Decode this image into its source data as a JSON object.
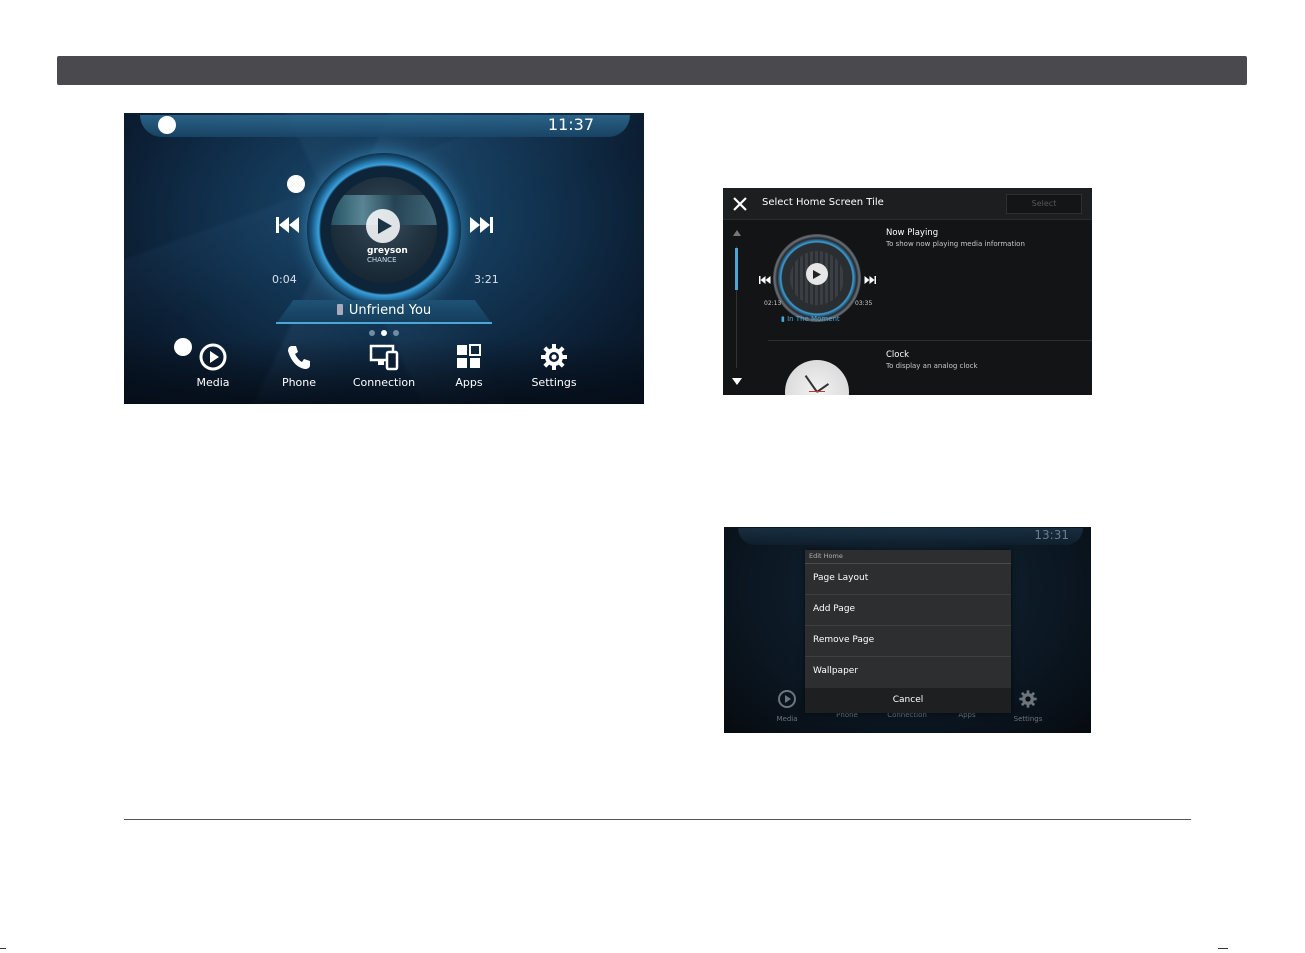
{
  "home_screen": {
    "clock": "11:37",
    "album_artist_line1": "greyson",
    "album_artist_line2": "CHANCE",
    "time_elapsed": "0:04",
    "time_total": "3:21",
    "song_title": "Unfriend You",
    "page_count": 3,
    "current_page": 2,
    "dock": [
      {
        "label": "Media",
        "icon": "media-play-icon"
      },
      {
        "label": "Phone",
        "icon": "phone-icon"
      },
      {
        "label": "Connection",
        "icon": "connection-icon"
      },
      {
        "label": "Apps",
        "icon": "apps-grid-icon"
      },
      {
        "label": "Settings",
        "icon": "gear-icon"
      }
    ]
  },
  "select_tile_screen": {
    "title": "Select Home Screen Tile",
    "select_button": "Select",
    "tiles": [
      {
        "name": "Now Playing",
        "description": "To show now playing media information",
        "preview_elapsed": "02:13",
        "preview_total": "03:35",
        "preview_song": "In The Moment"
      },
      {
        "name": "Clock",
        "description": "To display an analog clock"
      }
    ]
  },
  "edit_home_screen": {
    "clock": "13:31",
    "menu_title": "Edit Home",
    "menu_items": [
      "Page Layout",
      "Add Page",
      "Remove Page",
      "Wallpaper"
    ],
    "cancel_label": "Cancel",
    "dock": [
      "Media",
      "Phone",
      "Connection",
      "Apps",
      "Settings"
    ]
  },
  "colors": {
    "accent_blue": "#4aa7d8",
    "header_bar": "#4a4a4e",
    "panel_dark": "#121416",
    "menu_bg": "#2d2e30"
  }
}
